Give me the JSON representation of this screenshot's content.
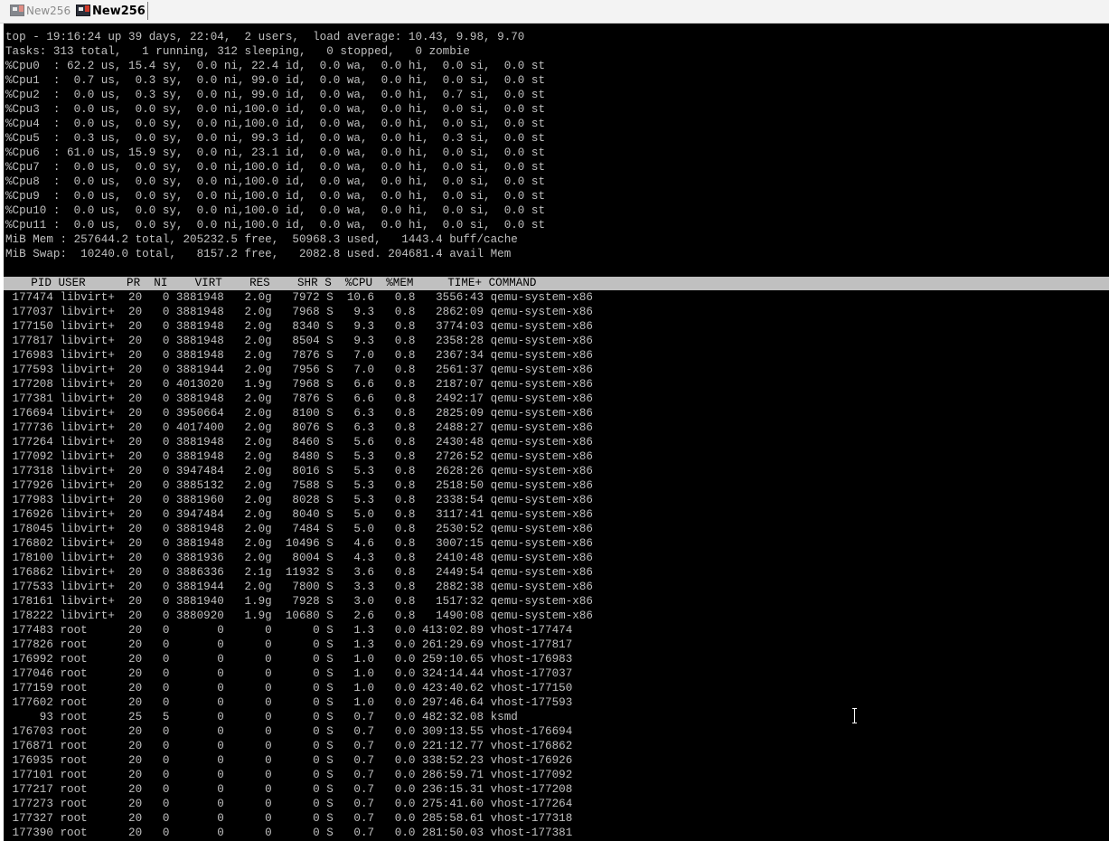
{
  "tabs": [
    {
      "label": "New256",
      "active": false
    },
    {
      "label": "New256",
      "active": true
    }
  ],
  "colors": {
    "terminal_background": "#000000",
    "terminal_foreground": "#c0c0c0",
    "header_highlight": "#c0c0c0",
    "tab_inactive_text": "#8b8b8b"
  },
  "icons": {
    "tab_icon": "terminal-session-icon",
    "cursor": "text-i-beam-cursor"
  },
  "summary": [
    "top - 19:16:24 up 39 days, 22:04,  2 users,  load average: 10.43, 9.98, 9.70",
    "Tasks: 313 total,   1 running, 312 sleeping,   0 stopped,   0 zombie",
    "%Cpu0  : 62.2 us, 15.4 sy,  0.0 ni, 22.4 id,  0.0 wa,  0.0 hi,  0.0 si,  0.0 st",
    "%Cpu1  :  0.7 us,  0.3 sy,  0.0 ni, 99.0 id,  0.0 wa,  0.0 hi,  0.0 si,  0.0 st",
    "%Cpu2  :  0.0 us,  0.3 sy,  0.0 ni, 99.0 id,  0.0 wa,  0.0 hi,  0.7 si,  0.0 st",
    "%Cpu3  :  0.0 us,  0.0 sy,  0.0 ni,100.0 id,  0.0 wa,  0.0 hi,  0.0 si,  0.0 st",
    "%Cpu4  :  0.0 us,  0.0 sy,  0.0 ni,100.0 id,  0.0 wa,  0.0 hi,  0.0 si,  0.0 st",
    "%Cpu5  :  0.3 us,  0.0 sy,  0.0 ni, 99.3 id,  0.0 wa,  0.0 hi,  0.3 si,  0.0 st",
    "%Cpu6  : 61.0 us, 15.9 sy,  0.0 ni, 23.1 id,  0.0 wa,  0.0 hi,  0.0 si,  0.0 st",
    "%Cpu7  :  0.0 us,  0.0 sy,  0.0 ni,100.0 id,  0.0 wa,  0.0 hi,  0.0 si,  0.0 st",
    "%Cpu8  :  0.0 us,  0.0 sy,  0.0 ni,100.0 id,  0.0 wa,  0.0 hi,  0.0 si,  0.0 st",
    "%Cpu9  :  0.0 us,  0.0 sy,  0.0 ni,100.0 id,  0.0 wa,  0.0 hi,  0.0 si,  0.0 st",
    "%Cpu10 :  0.0 us,  0.0 sy,  0.0 ni,100.0 id,  0.0 wa,  0.0 hi,  0.0 si,  0.0 st",
    "%Cpu11 :  0.0 us,  0.0 sy,  0.0 ni,100.0 id,  0.0 wa,  0.0 hi,  0.0 si,  0.0 st",
    "MiB Mem : 257644.2 total, 205232.5 free,  50968.3 used,   1443.4 buff/cache",
    "MiB Swap:  10240.0 total,   8157.2 free,   2082.8 used. 204681.4 avail Mem"
  ],
  "table_header": "    PID USER      PR  NI    VIRT    RES    SHR S  %CPU  %MEM     TIME+ COMMAND",
  "processes": [
    " 177474 libvirt+  20   0 3881948   2.0g   7972 S  10.6   0.8   3556:43 qemu-system-x86",
    " 177037 libvirt+  20   0 3881948   2.0g   7968 S   9.3   0.8   2862:09 qemu-system-x86",
    " 177150 libvirt+  20   0 3881948   2.0g   8340 S   9.3   0.8   3774:03 qemu-system-x86",
    " 177817 libvirt+  20   0 3881948   2.0g   8504 S   9.3   0.8   2358:28 qemu-system-x86",
    " 176983 libvirt+  20   0 3881948   2.0g   7876 S   7.0   0.8   2367:34 qemu-system-x86",
    " 177593 libvirt+  20   0 3881944   2.0g   7956 S   7.0   0.8   2561:37 qemu-system-x86",
    " 177208 libvirt+  20   0 4013020   1.9g   7968 S   6.6   0.8   2187:07 qemu-system-x86",
    " 177381 libvirt+  20   0 3881948   2.0g   7876 S   6.6   0.8   2492:17 qemu-system-x86",
    " 176694 libvirt+  20   0 3950664   2.0g   8100 S   6.3   0.8   2825:09 qemu-system-x86",
    " 177736 libvirt+  20   0 4017400   2.0g   8076 S   6.3   0.8   2488:27 qemu-system-x86",
    " 177264 libvirt+  20   0 3881948   2.0g   8460 S   5.6   0.8   2430:48 qemu-system-x86",
    " 177092 libvirt+  20   0 3881948   2.0g   8480 S   5.3   0.8   2726:52 qemu-system-x86",
    " 177318 libvirt+  20   0 3947484   2.0g   8016 S   5.3   0.8   2628:26 qemu-system-x86",
    " 177926 libvirt+  20   0 3885132   2.0g   7588 S   5.3   0.8   2518:50 qemu-system-x86",
    " 177983 libvirt+  20   0 3881960   2.0g   8028 S   5.3   0.8   2338:54 qemu-system-x86",
    " 176926 libvirt+  20   0 3947484   2.0g   8040 S   5.0   0.8   3117:41 qemu-system-x86",
    " 178045 libvirt+  20   0 3881948   2.0g   7484 S   5.0   0.8   2530:52 qemu-system-x86",
    " 176802 libvirt+  20   0 3881948   2.0g  10496 S   4.6   0.8   3007:15 qemu-system-x86",
    " 178100 libvirt+  20   0 3881936   2.0g   8004 S   4.3   0.8   2410:48 qemu-system-x86",
    " 176862 libvirt+  20   0 3886336   2.1g  11932 S   3.6   0.8   2449:54 qemu-system-x86",
    " 177533 libvirt+  20   0 3881944   2.0g   7800 S   3.3   0.8   2882:38 qemu-system-x86",
    " 178161 libvirt+  20   0 3881940   1.9g   7928 S   3.0   0.8   1517:32 qemu-system-x86",
    " 178222 libvirt+  20   0 3880920   1.9g  10680 S   2.6   0.8   1490:08 qemu-system-x86",
    " 177483 root      20   0       0      0      0 S   1.3   0.0 413:02.89 vhost-177474",
    " 177826 root      20   0       0      0      0 S   1.3   0.0 261:29.69 vhost-177817",
    " 176992 root      20   0       0      0      0 S   1.0   0.0 259:10.65 vhost-176983",
    " 177046 root      20   0       0      0      0 S   1.0   0.0 324:14.44 vhost-177037",
    " 177159 root      20   0       0      0      0 S   1.0   0.0 423:40.62 vhost-177150",
    " 177602 root      20   0       0      0      0 S   1.0   0.0 297:46.64 vhost-177593",
    "     93 root      25   5       0      0      0 S   0.7   0.0 482:32.08 ksmd",
    " 176703 root      20   0       0      0      0 S   0.7   0.0 309:13.55 vhost-176694",
    " 176871 root      20   0       0      0      0 S   0.7   0.0 221:12.77 vhost-176862",
    " 176935 root      20   0       0      0      0 S   0.7   0.0 338:52.23 vhost-176926",
    " 177101 root      20   0       0      0      0 S   0.7   0.0 286:59.71 vhost-177092",
    " 177217 root      20   0       0      0      0 S   0.7   0.0 236:15.31 vhost-177208",
    " 177273 root      20   0       0      0      0 S   0.7   0.0 275:41.60 vhost-177264",
    " 177327 root      20   0       0      0      0 S   0.7   0.0 285:58.61 vhost-177318",
    " 177390 root      20   0       0      0      0 S   0.7   0.0 281:50.03 vhost-177381"
  ]
}
